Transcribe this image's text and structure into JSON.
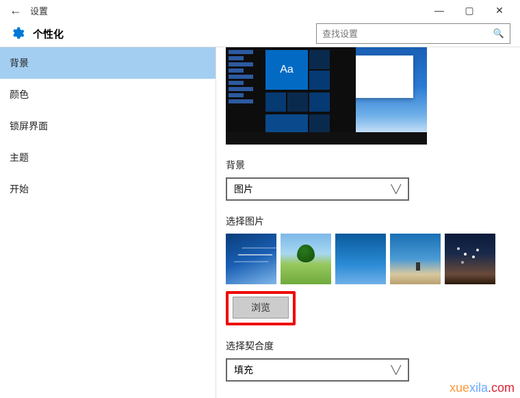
{
  "titlebar": {
    "title": "设置"
  },
  "header": {
    "page_title": "个性化",
    "search_placeholder": "查找设置"
  },
  "sidebar": {
    "items": [
      {
        "label": "背景",
        "selected": true
      },
      {
        "label": "颜色"
      },
      {
        "label": "锁屏界面"
      },
      {
        "label": "主题"
      },
      {
        "label": "开始"
      }
    ]
  },
  "content": {
    "preview_sample_text": "Aa",
    "background_label": "背景",
    "background_select": {
      "value": "图片"
    },
    "choose_picture_label": "选择图片",
    "browse_button": "浏览",
    "fit_label": "选择契合度",
    "fit_select": {
      "value": "填充"
    }
  },
  "watermark": {
    "a": "xue",
    "b": "xila",
    "c": ".com"
  }
}
